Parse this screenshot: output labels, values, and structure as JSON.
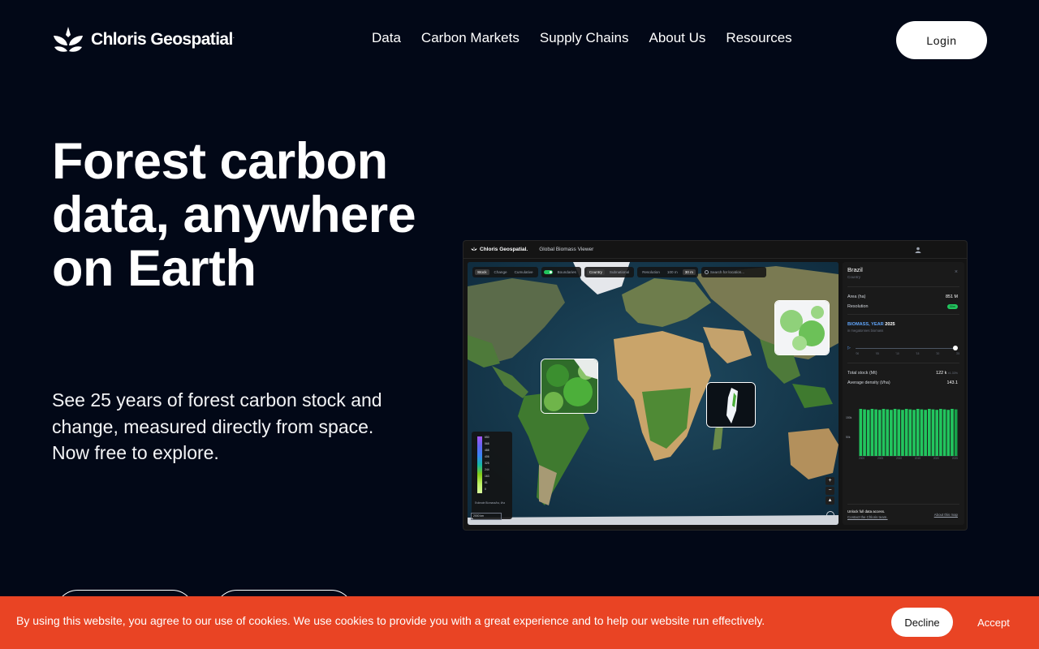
{
  "nav": {
    "logo_text": "Chloris Geospatial",
    "logo_tm": ".",
    "links": [
      "Data",
      "Carbon Markets",
      "Supply Chains",
      "About Us",
      "Resources"
    ],
    "login_label": "Login"
  },
  "hero": {
    "title": "Forest carbon data, anywhere on Earth",
    "subtitle": "See 25 years of forest carbon stock and change, measured directly from space. Now free to explore."
  },
  "app": {
    "brand": "Chloris Geospatial.",
    "app_name": "Global Biomass Viewer",
    "toolbar": {
      "mode_options": [
        "Stock",
        "Change",
        "Cumulative"
      ],
      "mode_selected": "Stock",
      "boundaries_label": "Boundaries",
      "boundary_options": [
        "Country",
        "Subnational"
      ],
      "boundary_selected": "Country",
      "resolution_label": "Resolution",
      "resolution_options": [
        "100 m",
        "30 m"
      ],
      "resolution_selected": "30 m",
      "search_placeholder": "Search for location..."
    },
    "legend": {
      "ticks": [
        "650",
        "568",
        "488",
        "406",
        "325",
        "244",
        "163",
        "81",
        "0"
      ],
      "caption": "Estimate Biomass/ha, t/ha",
      "scale": "2000 km"
    },
    "zoom": {
      "in": "+",
      "out": "−",
      "reset": "▴"
    },
    "panel": {
      "country": "Brazil",
      "level": "Country",
      "close": "×",
      "area_label": "Area (ha)",
      "area_value": "851 M",
      "resolution_label": "Resolution",
      "resolution_value": "30m",
      "section_label": "BIOMASS, YEAR",
      "section_year": "2025",
      "section_note": "in megatonnes biomass",
      "timeline_labels": [
        "'00",
        "'05",
        "'10",
        "'15",
        "'20",
        "'25"
      ],
      "total_label": "Total stock (Mt)",
      "total_value": "122 k",
      "total_note": "±1.33%",
      "density_label": "Average density (t/ha)",
      "density_value": "143.1",
      "chart_y_labels": [
        "150k",
        "50k"
      ],
      "chart_x_labels": [
        "2000",
        "2005",
        "2010",
        "2015",
        "2020",
        "2025"
      ],
      "footer_line1": "Unlock full data access.",
      "footer_line2": "Contact the Chloris team.",
      "footer_link": "About this map"
    }
  },
  "cookie": {
    "text": "By using this website, you agree to our use of cookies. We use cookies to provide you with a great experience and to help our website run effectively.",
    "decline_label": "Decline",
    "accept_label": "Accept"
  },
  "colors": {
    "background": "#020817",
    "cookie_banner": "#e94424",
    "accent_green": "#22c55e"
  }
}
